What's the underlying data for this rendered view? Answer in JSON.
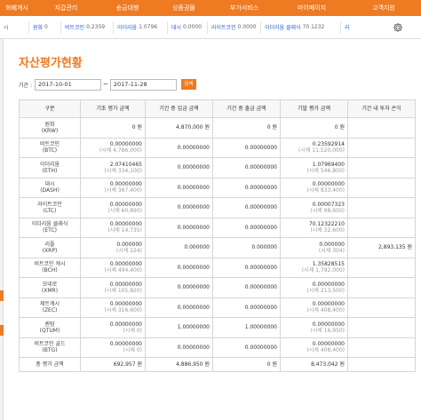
{
  "nav": {
    "items": [
      "화폐개시",
      "지갑관리",
      "송금대행",
      "상품권몰",
      "부가서비스",
      "마이페이지",
      "고객지원"
    ]
  },
  "ticker": [
    {
      "name": "원화",
      "value": "0"
    },
    {
      "name": "비트코인",
      "value": "0.2359"
    },
    {
      "name": "이더리움",
      "value": "1.0796"
    },
    {
      "name": "대시",
      "value": "0.0000"
    },
    {
      "name": "라이트코인",
      "value": "0.0000"
    },
    {
      "name": "이더리움 클래식",
      "value": "70.1232"
    },
    {
      "name": "리",
      "value": ""
    }
  ],
  "ticker_prefix": "시",
  "page": {
    "title": "자산평가현황"
  },
  "filter": {
    "label": "기간 :",
    "start": "2017-10-01",
    "separator": "~",
    "end": "2017-11-28",
    "search_label": "검색"
  },
  "table": {
    "headers": [
      "구분",
      "기초 평가 금액",
      "기간 중 입금 금액",
      "기간 중 출금 금액",
      "기말 평가 금액",
      "기간 내 투자 손익"
    ],
    "rows": [
      {
        "name": "원화",
        "code": "(KRW)",
        "begin": "0 원",
        "begin_sub": "",
        "deposit": "4,870,000 원",
        "withdraw": "0 원",
        "end": "0 원",
        "end_sub": "",
        "pnl": ""
      },
      {
        "name": "비트코인",
        "code": "(BTC)",
        "begin": "0.00000000",
        "begin_sub": "(시세 4,786,000)",
        "deposit": "0.00000000",
        "withdraw": "0.00000000",
        "end": "0.23592914",
        "end_sub": "(시세 11,520,000)",
        "pnl": ""
      },
      {
        "name": "이더리움",
        "code": "(ETH)",
        "begin": "2.07410465",
        "begin_sub": "(시세 334,100)",
        "deposit": "0.00000000",
        "withdraw": "0.00000000",
        "end": "1.07969400",
        "end_sub": "(시세 546,800)",
        "pnl": ""
      },
      {
        "name": "대시",
        "code": "(DASH)",
        "begin": "0.00000000",
        "begin_sub": "(시세 367,400)",
        "deposit": "0.00000000",
        "withdraw": "0.00000000",
        "end": "0.00000000",
        "end_sub": "(시세 833,400)",
        "pnl": ""
      },
      {
        "name": "라이트코인",
        "code": "(LTC)",
        "begin": "0.00000000",
        "begin_sub": "(시세 60,890)",
        "deposit": "0.00000000",
        "withdraw": "0.00000000",
        "end": "0.00007323",
        "end_sub": "(시세 98,600)",
        "pnl": ""
      },
      {
        "name": "이더리움 클래식",
        "code": "(ETC)",
        "begin": "0.00000000",
        "begin_sub": "(시세 14,735)",
        "deposit": "0.00000000",
        "withdraw": "0.00000000",
        "end": "70.12322210",
        "end_sub": "(시세 32,600)",
        "pnl": ""
      },
      {
        "name": "리플",
        "code": "(XRP)",
        "begin": "0.000000",
        "begin_sub": "(시세 224)",
        "deposit": "0.000000",
        "withdraw": "0.000000",
        "end": "0.000000",
        "end_sub": "(시세 304)",
        "pnl": "2,893,135 원"
      },
      {
        "name": "비트코인 캐시",
        "code": "(BCH)",
        "begin": "0.00000000",
        "begin_sub": "(시세 494,400)",
        "deposit": "0.00000000",
        "withdraw": "0.00000000",
        "end": "1.35828515",
        "end_sub": "(시세 1,792,000)",
        "pnl": ""
      },
      {
        "name": "모네로",
        "code": "(XMR)",
        "begin": "0.00000000",
        "begin_sub": "(시세 105,820)",
        "deposit": "0.00000000",
        "withdraw": "0.00000000",
        "end": "0.00000000",
        "end_sub": "(시세 213,500)",
        "pnl": ""
      },
      {
        "name": "제트캐시",
        "code": "(ZEC)",
        "begin": "0.00000000",
        "begin_sub": "(시세 316,600)",
        "deposit": "0.00000000",
        "withdraw": "0.00000000",
        "end": "0.00000000",
        "end_sub": "(시세 408,400)",
        "pnl": ""
      },
      {
        "name": "퀀텀",
        "code": "(QTUM)",
        "begin": "0.00000000",
        "begin_sub": "(시세 0)",
        "deposit": "1.00000000",
        "withdraw": "1.00000000",
        "end": "0.00000000",
        "end_sub": "(시세 16,950)",
        "pnl": ""
      },
      {
        "name": "비트코인 골드",
        "code": "(BTG)",
        "begin": "0.00000000",
        "begin_sub": "(시세 0)",
        "deposit": "0.00000000",
        "withdraw": "0.00000000",
        "end": "0.00000000",
        "end_sub": "(시세 408,400)",
        "pnl": ""
      }
    ],
    "total": {
      "name": "총 평가 금액",
      "begin": "692,957 원",
      "deposit": "4,886,950 원",
      "withdraw": "0 원",
      "end": "8,473,042 원",
      "pnl": ""
    }
  },
  "colors": {
    "accent": "#ee7a22",
    "link": "#2a5bd7"
  },
  "icons": {
    "settings": "gear-icon"
  }
}
